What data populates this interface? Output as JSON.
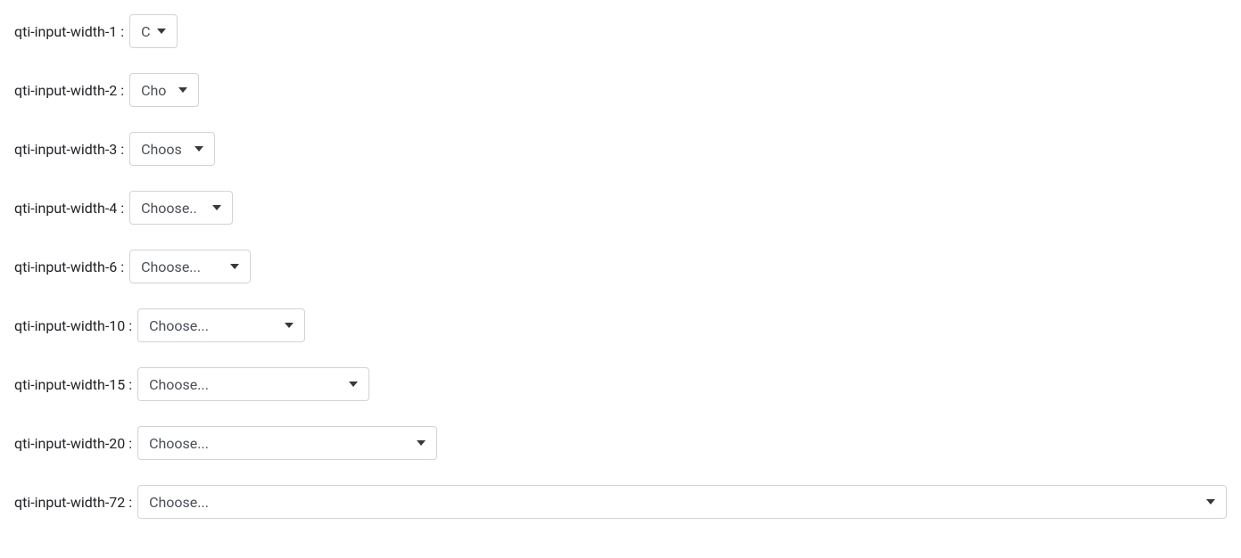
{
  "rows": [
    {
      "label": "qti-input-width-1 :",
      "text": "C",
      "wclass": "w1",
      "name": "dropdown-width-1"
    },
    {
      "label": "qti-input-width-2 :",
      "text": "Cho",
      "wclass": "w2",
      "name": "dropdown-width-2"
    },
    {
      "label": "qti-input-width-3 :",
      "text": "Choos",
      "wclass": "w3",
      "name": "dropdown-width-3"
    },
    {
      "label": "qti-input-width-4 :",
      "text": "Choose..",
      "wclass": "w4",
      "name": "dropdown-width-4"
    },
    {
      "label": "qti-input-width-6 :",
      "text": "Choose...",
      "wclass": "w6",
      "name": "dropdown-width-6"
    },
    {
      "label": "qti-input-width-10 :",
      "text": "Choose...",
      "wclass": "w10",
      "name": "dropdown-width-10"
    },
    {
      "label": "qti-input-width-15 :",
      "text": "Choose...",
      "wclass": "w15",
      "name": "dropdown-width-15"
    },
    {
      "label": "qti-input-width-20 :",
      "text": "Choose...",
      "wclass": "w20",
      "name": "dropdown-width-20"
    },
    {
      "label": "qti-input-width-72 :",
      "text": "Choose...",
      "wclass": "w72",
      "name": "dropdown-width-72"
    }
  ]
}
